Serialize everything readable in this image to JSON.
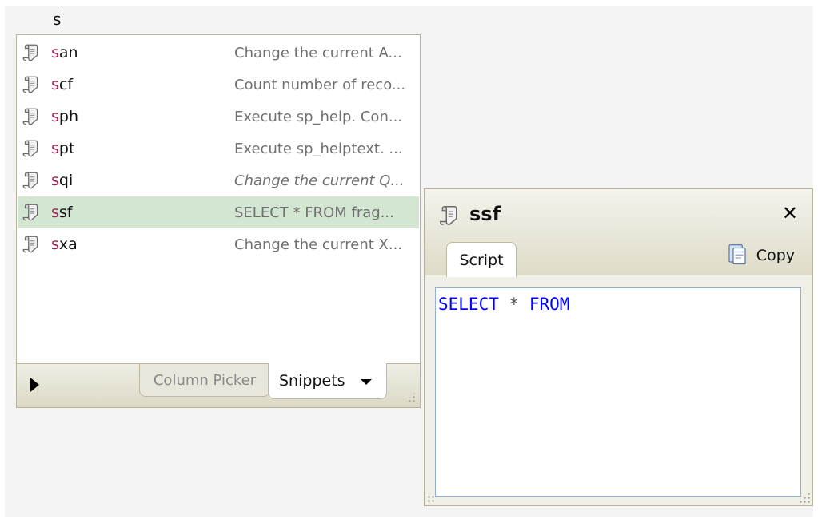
{
  "editor": {
    "typed_text": "s"
  },
  "completion_list": {
    "items": [
      {
        "match": "s",
        "rest": "an",
        "description": "Change the current A...",
        "italic": false,
        "selected": false
      },
      {
        "match": "s",
        "rest": "cf",
        "description": "Count number of reco...",
        "italic": false,
        "selected": false
      },
      {
        "match": "s",
        "rest": "ph",
        "description": "Execute sp_help. Con...",
        "italic": false,
        "selected": false
      },
      {
        "match": "s",
        "rest": "pt",
        "description": "Execute sp_helptext. ...",
        "italic": false,
        "selected": false
      },
      {
        "match": "s",
        "rest": "qi",
        "description": "Change the current Q...",
        "italic": true,
        "selected": false
      },
      {
        "match": "s",
        "rest": "sf",
        "description": "SELECT * FROM frag...",
        "italic": false,
        "selected": true
      },
      {
        "match": "s",
        "rest": "xa",
        "description": "Change the current X...",
        "italic": false,
        "selected": false
      }
    ],
    "tabs": {
      "column_picker": "Column Picker",
      "snippets": "Snippets"
    },
    "icon": "snippet-scroll-icon"
  },
  "detail": {
    "title": "ssf",
    "close_glyph": "✕",
    "tab_label": "Script",
    "copy_label": "Copy",
    "script": {
      "kw1": "SELECT",
      "op": "*",
      "kw2": "FROM"
    },
    "icons": [
      "snippet-scroll-icon",
      "copy-clipboard-icon",
      "close-icon"
    ]
  },
  "colors": {
    "match_highlight": "#a3205a",
    "selected_row": "#d3e6d1",
    "sql_keyword": "#0000ff",
    "description_text": "#707070",
    "panel_border": "#b8b29a"
  }
}
